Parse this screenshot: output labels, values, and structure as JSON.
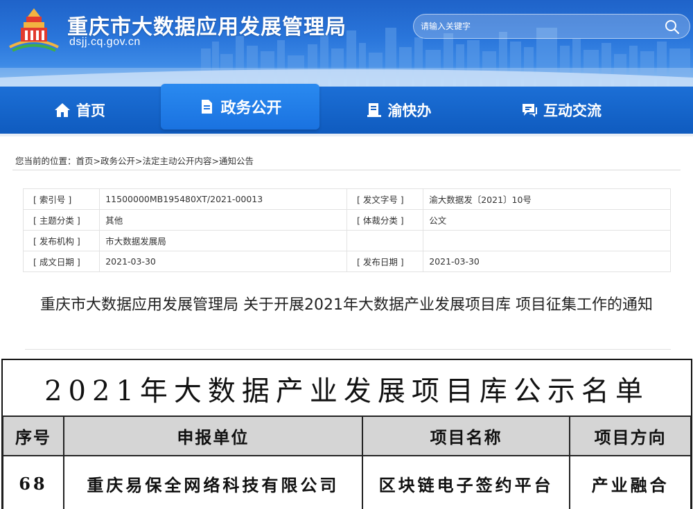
{
  "header": {
    "title": "重庆市大数据应用发展管理局",
    "domain": "dsjj.cq.gov.cn",
    "search_placeholder": "请输入关键字"
  },
  "nav": [
    {
      "label": "首页",
      "icon": "home-icon"
    },
    {
      "label": "政务公开",
      "icon": "document-icon",
      "active": true
    },
    {
      "label": "渝快办",
      "icon": "service-icon"
    },
    {
      "label": "互动交流",
      "icon": "chat-icon"
    }
  ],
  "breadcrumb": {
    "prefix": "您当前的位置：",
    "items": [
      "首页",
      "政务公开",
      "法定主动公开内容",
      "通知公告"
    ],
    "separator": ">"
  },
  "info": {
    "index_label": "[ 索引号 ]",
    "index_value": "11500000MB195480XT/2021-00013",
    "doc_no_label": "[ 发文字号 ]",
    "doc_no_value": "渝大数据发〔2021〕10号",
    "topic_label": "[ 主题分类 ]",
    "topic_value": "其他",
    "genre_label": "[ 体裁分类 ]",
    "genre_value": "公文",
    "issuer_label": "[ 发布机构 ]",
    "issuer_value": "市大数据发展局",
    "created_label": "[ 成文日期 ]",
    "created_value": "2021-03-30",
    "published_label": "[ 发布日期 ]",
    "published_value": "2021-03-30"
  },
  "notice": {
    "title": "重庆市大数据应用发展管理局 关于开展2021年大数据产业发展项目库 项目征集工作的通知"
  },
  "list": {
    "title": "2021年大数据产业发展项目库公示名单",
    "headers": [
      "序号",
      "申报单位",
      "项目名称",
      "项目方向"
    ],
    "rows": [
      [
        "68",
        "重庆易保全网络科技有限公司",
        "区块链电子签约平台",
        "产业融合"
      ]
    ]
  },
  "colors": {
    "header_blue": "#2a76db",
    "nav_blue": "#0f5bbf",
    "nav_active": "#1a72e0",
    "table_header_gray": "#d5d5d5"
  }
}
